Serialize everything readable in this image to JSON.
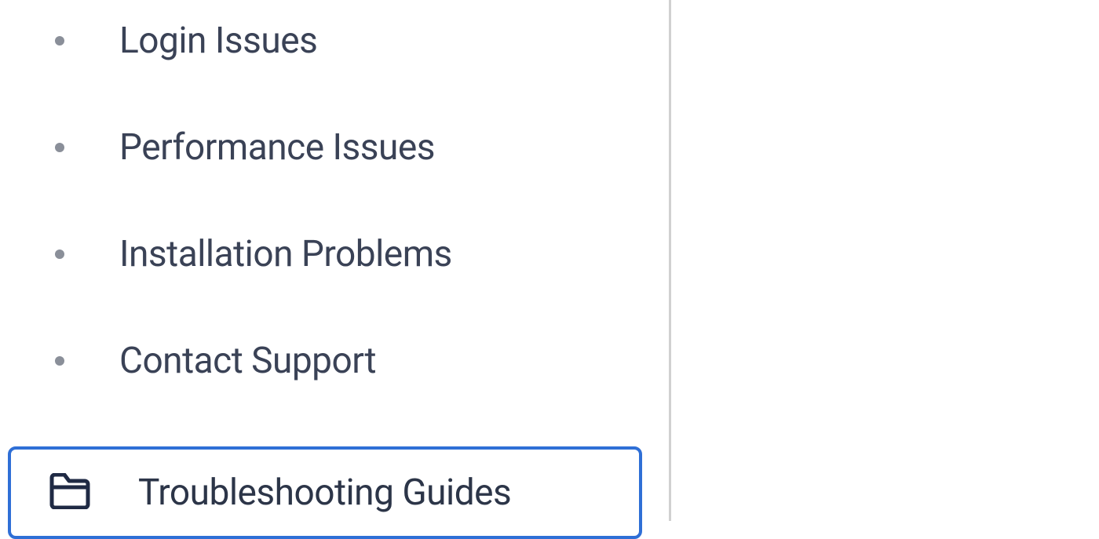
{
  "sidebar": {
    "items": [
      {
        "label": "Login Issues"
      },
      {
        "label": "Performance Issues"
      },
      {
        "label": "Installation Problems"
      },
      {
        "label": "Contact Support"
      }
    ],
    "folder": {
      "label": "Troubleshooting Guides"
    }
  }
}
